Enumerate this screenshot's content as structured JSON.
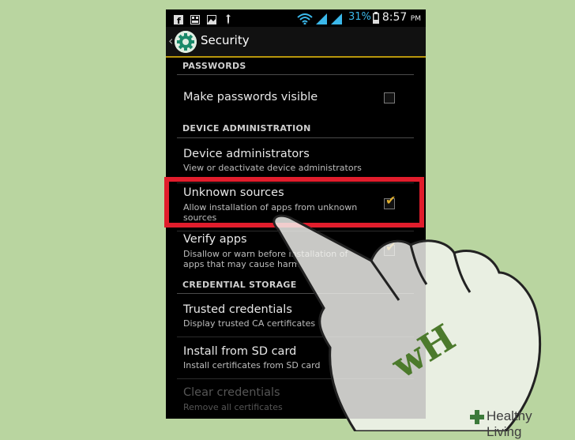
{
  "status_bar": {
    "battery_percent": "31%",
    "time": "8:57",
    "time_suffix": "PM",
    "icons": [
      "facebook-icon",
      "gallery-icon",
      "image-icon",
      "usb-icon",
      "wifi-icon",
      "signal-icon",
      "signal-icon",
      "battery-icon"
    ]
  },
  "action_bar": {
    "title": "Security"
  },
  "sections": {
    "passwords": "PASSWORDS",
    "device_admin": "DEVICE ADMINISTRATION",
    "credential_storage": "CREDENTIAL STORAGE"
  },
  "items": {
    "make_passwords_visible": {
      "title": "Make passwords visible",
      "checked": false
    },
    "device_administrators": {
      "title": "Device administrators",
      "subtitle": "View or deactivate device administrators"
    },
    "unknown_sources": {
      "title": "Unknown sources",
      "subtitle": "Allow installation of apps from unknown sources",
      "checked": true
    },
    "verify_apps": {
      "title": "Verify apps",
      "subtitle": "Disallow or warn before installation of apps that may cause harm",
      "checked": true
    },
    "trusted_credentials": {
      "title": "Trusted credentials",
      "subtitle": "Display trusted CA certificates"
    },
    "install_sd": {
      "title": "Install from SD card",
      "subtitle": "Install certificates from SD card"
    },
    "clear_credentials": {
      "title": "Clear credentials",
      "subtitle": "Remove all certificates",
      "enabled": false
    }
  },
  "watermark": {
    "hand_mark": "wH",
    "logo_text": "Healthy Living"
  },
  "colors": {
    "background": "#b9d5a0",
    "highlight": "#e11d2c",
    "accent": "#3bb8ea",
    "check": "#e0b030"
  }
}
